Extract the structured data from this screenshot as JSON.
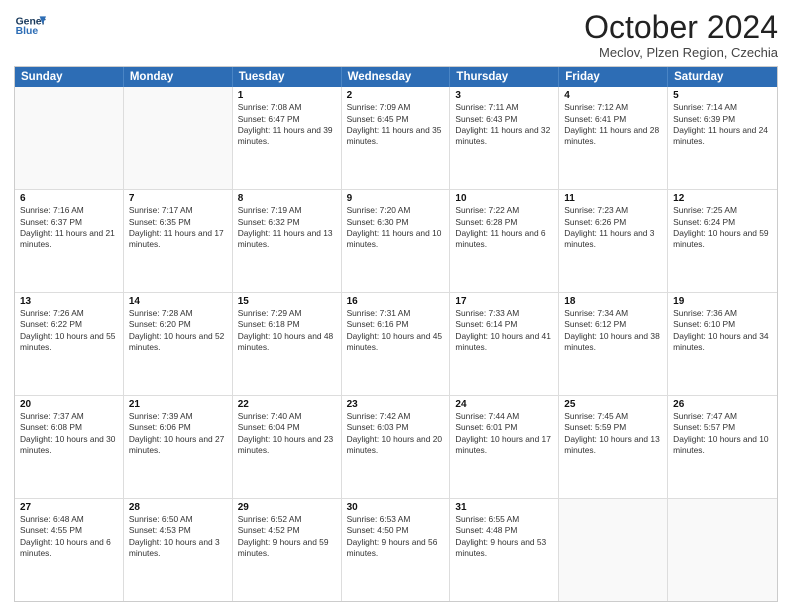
{
  "header": {
    "logo_line1": "General",
    "logo_line2": "Blue",
    "month_title": "October 2024",
    "location": "Meclov, Plzen Region, Czechia"
  },
  "days_of_week": [
    "Sunday",
    "Monday",
    "Tuesday",
    "Wednesday",
    "Thursday",
    "Friday",
    "Saturday"
  ],
  "weeks": [
    [
      {
        "day": "",
        "text": "",
        "empty": true
      },
      {
        "day": "",
        "text": "",
        "empty": true
      },
      {
        "day": "1",
        "text": "Sunrise: 7:08 AM\nSunset: 6:47 PM\nDaylight: 11 hours and 39 minutes."
      },
      {
        "day": "2",
        "text": "Sunrise: 7:09 AM\nSunset: 6:45 PM\nDaylight: 11 hours and 35 minutes."
      },
      {
        "day": "3",
        "text": "Sunrise: 7:11 AM\nSunset: 6:43 PM\nDaylight: 11 hours and 32 minutes."
      },
      {
        "day": "4",
        "text": "Sunrise: 7:12 AM\nSunset: 6:41 PM\nDaylight: 11 hours and 28 minutes."
      },
      {
        "day": "5",
        "text": "Sunrise: 7:14 AM\nSunset: 6:39 PM\nDaylight: 11 hours and 24 minutes."
      }
    ],
    [
      {
        "day": "6",
        "text": "Sunrise: 7:16 AM\nSunset: 6:37 PM\nDaylight: 11 hours and 21 minutes."
      },
      {
        "day": "7",
        "text": "Sunrise: 7:17 AM\nSunset: 6:35 PM\nDaylight: 11 hours and 17 minutes."
      },
      {
        "day": "8",
        "text": "Sunrise: 7:19 AM\nSunset: 6:32 PM\nDaylight: 11 hours and 13 minutes."
      },
      {
        "day": "9",
        "text": "Sunrise: 7:20 AM\nSunset: 6:30 PM\nDaylight: 11 hours and 10 minutes."
      },
      {
        "day": "10",
        "text": "Sunrise: 7:22 AM\nSunset: 6:28 PM\nDaylight: 11 hours and 6 minutes."
      },
      {
        "day": "11",
        "text": "Sunrise: 7:23 AM\nSunset: 6:26 PM\nDaylight: 11 hours and 3 minutes."
      },
      {
        "day": "12",
        "text": "Sunrise: 7:25 AM\nSunset: 6:24 PM\nDaylight: 10 hours and 59 minutes."
      }
    ],
    [
      {
        "day": "13",
        "text": "Sunrise: 7:26 AM\nSunset: 6:22 PM\nDaylight: 10 hours and 55 minutes."
      },
      {
        "day": "14",
        "text": "Sunrise: 7:28 AM\nSunset: 6:20 PM\nDaylight: 10 hours and 52 minutes."
      },
      {
        "day": "15",
        "text": "Sunrise: 7:29 AM\nSunset: 6:18 PM\nDaylight: 10 hours and 48 minutes."
      },
      {
        "day": "16",
        "text": "Sunrise: 7:31 AM\nSunset: 6:16 PM\nDaylight: 10 hours and 45 minutes."
      },
      {
        "day": "17",
        "text": "Sunrise: 7:33 AM\nSunset: 6:14 PM\nDaylight: 10 hours and 41 minutes."
      },
      {
        "day": "18",
        "text": "Sunrise: 7:34 AM\nSunset: 6:12 PM\nDaylight: 10 hours and 38 minutes."
      },
      {
        "day": "19",
        "text": "Sunrise: 7:36 AM\nSunset: 6:10 PM\nDaylight: 10 hours and 34 minutes."
      }
    ],
    [
      {
        "day": "20",
        "text": "Sunrise: 7:37 AM\nSunset: 6:08 PM\nDaylight: 10 hours and 30 minutes."
      },
      {
        "day": "21",
        "text": "Sunrise: 7:39 AM\nSunset: 6:06 PM\nDaylight: 10 hours and 27 minutes."
      },
      {
        "day": "22",
        "text": "Sunrise: 7:40 AM\nSunset: 6:04 PM\nDaylight: 10 hours and 23 minutes."
      },
      {
        "day": "23",
        "text": "Sunrise: 7:42 AM\nSunset: 6:03 PM\nDaylight: 10 hours and 20 minutes."
      },
      {
        "day": "24",
        "text": "Sunrise: 7:44 AM\nSunset: 6:01 PM\nDaylight: 10 hours and 17 minutes."
      },
      {
        "day": "25",
        "text": "Sunrise: 7:45 AM\nSunset: 5:59 PM\nDaylight: 10 hours and 13 minutes."
      },
      {
        "day": "26",
        "text": "Sunrise: 7:47 AM\nSunset: 5:57 PM\nDaylight: 10 hours and 10 minutes."
      }
    ],
    [
      {
        "day": "27",
        "text": "Sunrise: 6:48 AM\nSunset: 4:55 PM\nDaylight: 10 hours and 6 minutes."
      },
      {
        "day": "28",
        "text": "Sunrise: 6:50 AM\nSunset: 4:53 PM\nDaylight: 10 hours and 3 minutes."
      },
      {
        "day": "29",
        "text": "Sunrise: 6:52 AM\nSunset: 4:52 PM\nDaylight: 9 hours and 59 minutes."
      },
      {
        "day": "30",
        "text": "Sunrise: 6:53 AM\nSunset: 4:50 PM\nDaylight: 9 hours and 56 minutes."
      },
      {
        "day": "31",
        "text": "Sunrise: 6:55 AM\nSunset: 4:48 PM\nDaylight: 9 hours and 53 minutes."
      },
      {
        "day": "",
        "text": "",
        "empty": true
      },
      {
        "day": "",
        "text": "",
        "empty": true
      }
    ]
  ]
}
